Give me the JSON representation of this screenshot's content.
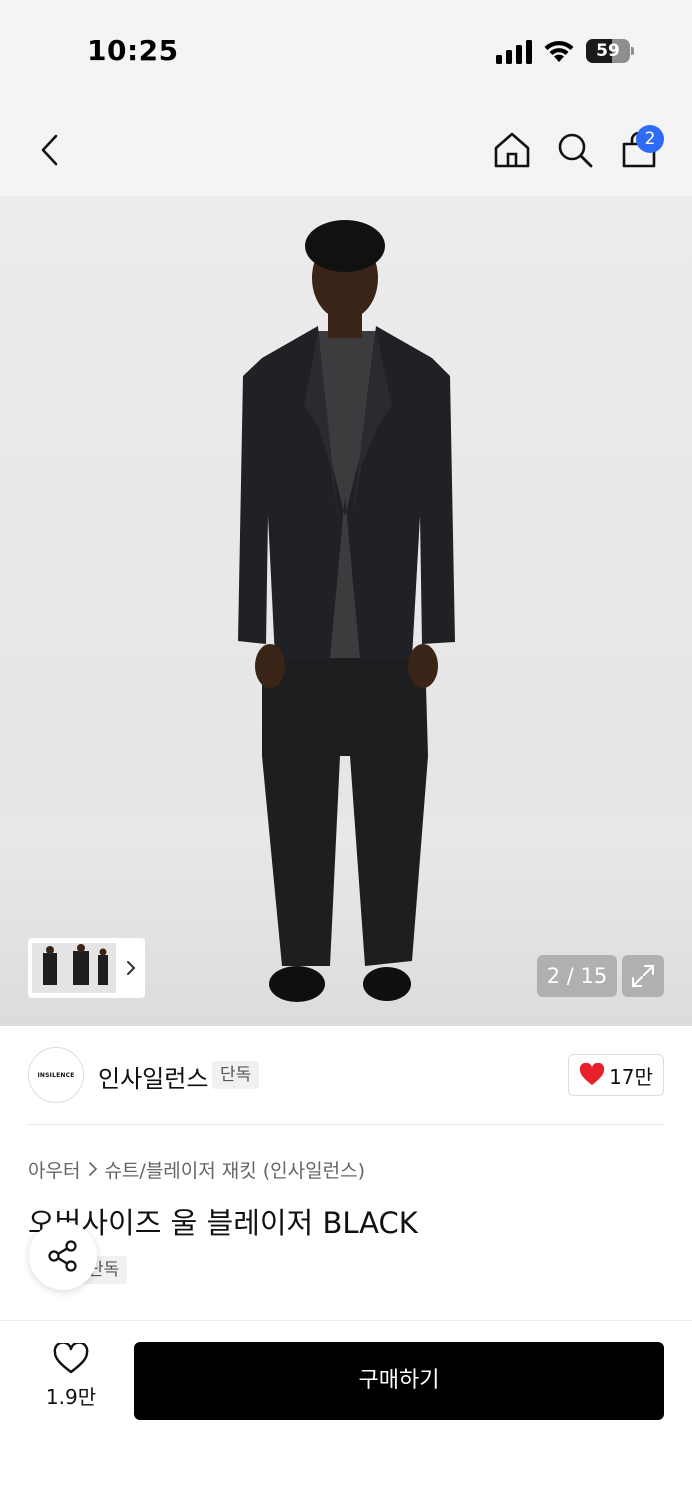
{
  "status_bar": {
    "time": "10:25",
    "battery_level": "59",
    "battery_fraction": 0.59
  },
  "nav": {
    "cart_count": "2",
    "icons": [
      "back-icon",
      "home-icon",
      "search-icon",
      "shopping-bag-icon"
    ]
  },
  "gallery": {
    "counter": "2 / 15",
    "current_index": 2,
    "total": 15
  },
  "brand": {
    "logo_text": "INSILENCE",
    "name": "인사일런스",
    "tag": "단독",
    "like_count": "17만",
    "accent_color": "#e8202a"
  },
  "breadcrumb": [
    {
      "label": "아우터"
    },
    {
      "label": "슈트/블레이저 재킷 (인사일런스)"
    }
  ],
  "product": {
    "title": "오버사이즈 울 블레이저 BLACK",
    "tag": "단독"
  },
  "bottom": {
    "wish_count": "1.9만",
    "buy_label": "구매하기"
  },
  "colors": {
    "cart_badge": "#2f6cf6",
    "buy_button": "#000000"
  }
}
